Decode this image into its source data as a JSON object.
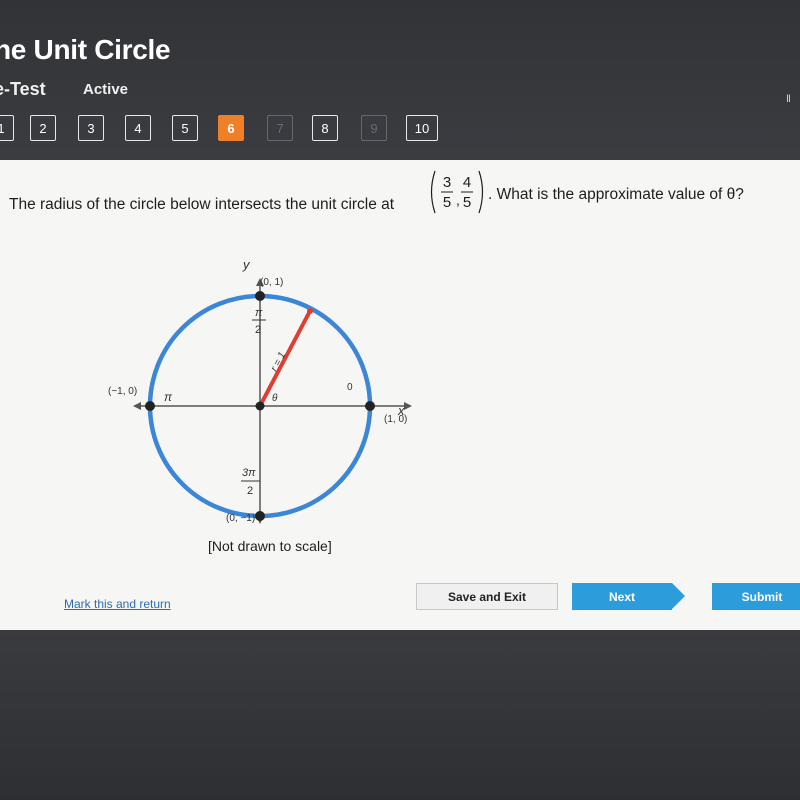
{
  "header": {
    "title": "he Unit Circle",
    "subtitle": "e-Test",
    "status": "Active",
    "top_right_glyph": "Ⅱ"
  },
  "question_nav": {
    "items": [
      {
        "label": "1",
        "state": "normal"
      },
      {
        "label": "2",
        "state": "normal"
      },
      {
        "label": "3",
        "state": "normal"
      },
      {
        "label": "4",
        "state": "normal"
      },
      {
        "label": "5",
        "state": "normal"
      },
      {
        "label": "6",
        "state": "current"
      },
      {
        "label": "7",
        "state": "disabled"
      },
      {
        "label": "8",
        "state": "normal"
      },
      {
        "label": "9",
        "state": "disabled"
      },
      {
        "label": "10",
        "state": "normal"
      }
    ]
  },
  "question": {
    "text_before": "The radius of the circle below intersects the unit circle at",
    "point_x_num": "3",
    "point_x_den": "5",
    "point_y_num": "4",
    "point_y_den": "5",
    "text_after": ". What is the approximate value of θ?"
  },
  "diagram": {
    "y_axis_label": "y",
    "x_axis_label": "x",
    "top_point": "(0, 1)",
    "left_point": "(−1, 0)",
    "right_point": "(1, 0)",
    "bottom_point": "(0, −1)",
    "pi_half_num": "π",
    "pi_half_den": "2",
    "pi_label": "π",
    "three_pi_half_num": "3π",
    "three_pi_half_den": "2",
    "zero_label": "0",
    "theta_label": "θ",
    "radius_label": "r = 1",
    "caption": "[Not drawn to scale]",
    "colors": {
      "circle": "#3b86d6",
      "radius": "#e03c31",
      "axis": "#555555",
      "point": "#222222"
    }
  },
  "footer": {
    "mark_link": "Mark this and return",
    "save_exit": "Save and Exit",
    "next": "Next",
    "submit": "Submit"
  }
}
